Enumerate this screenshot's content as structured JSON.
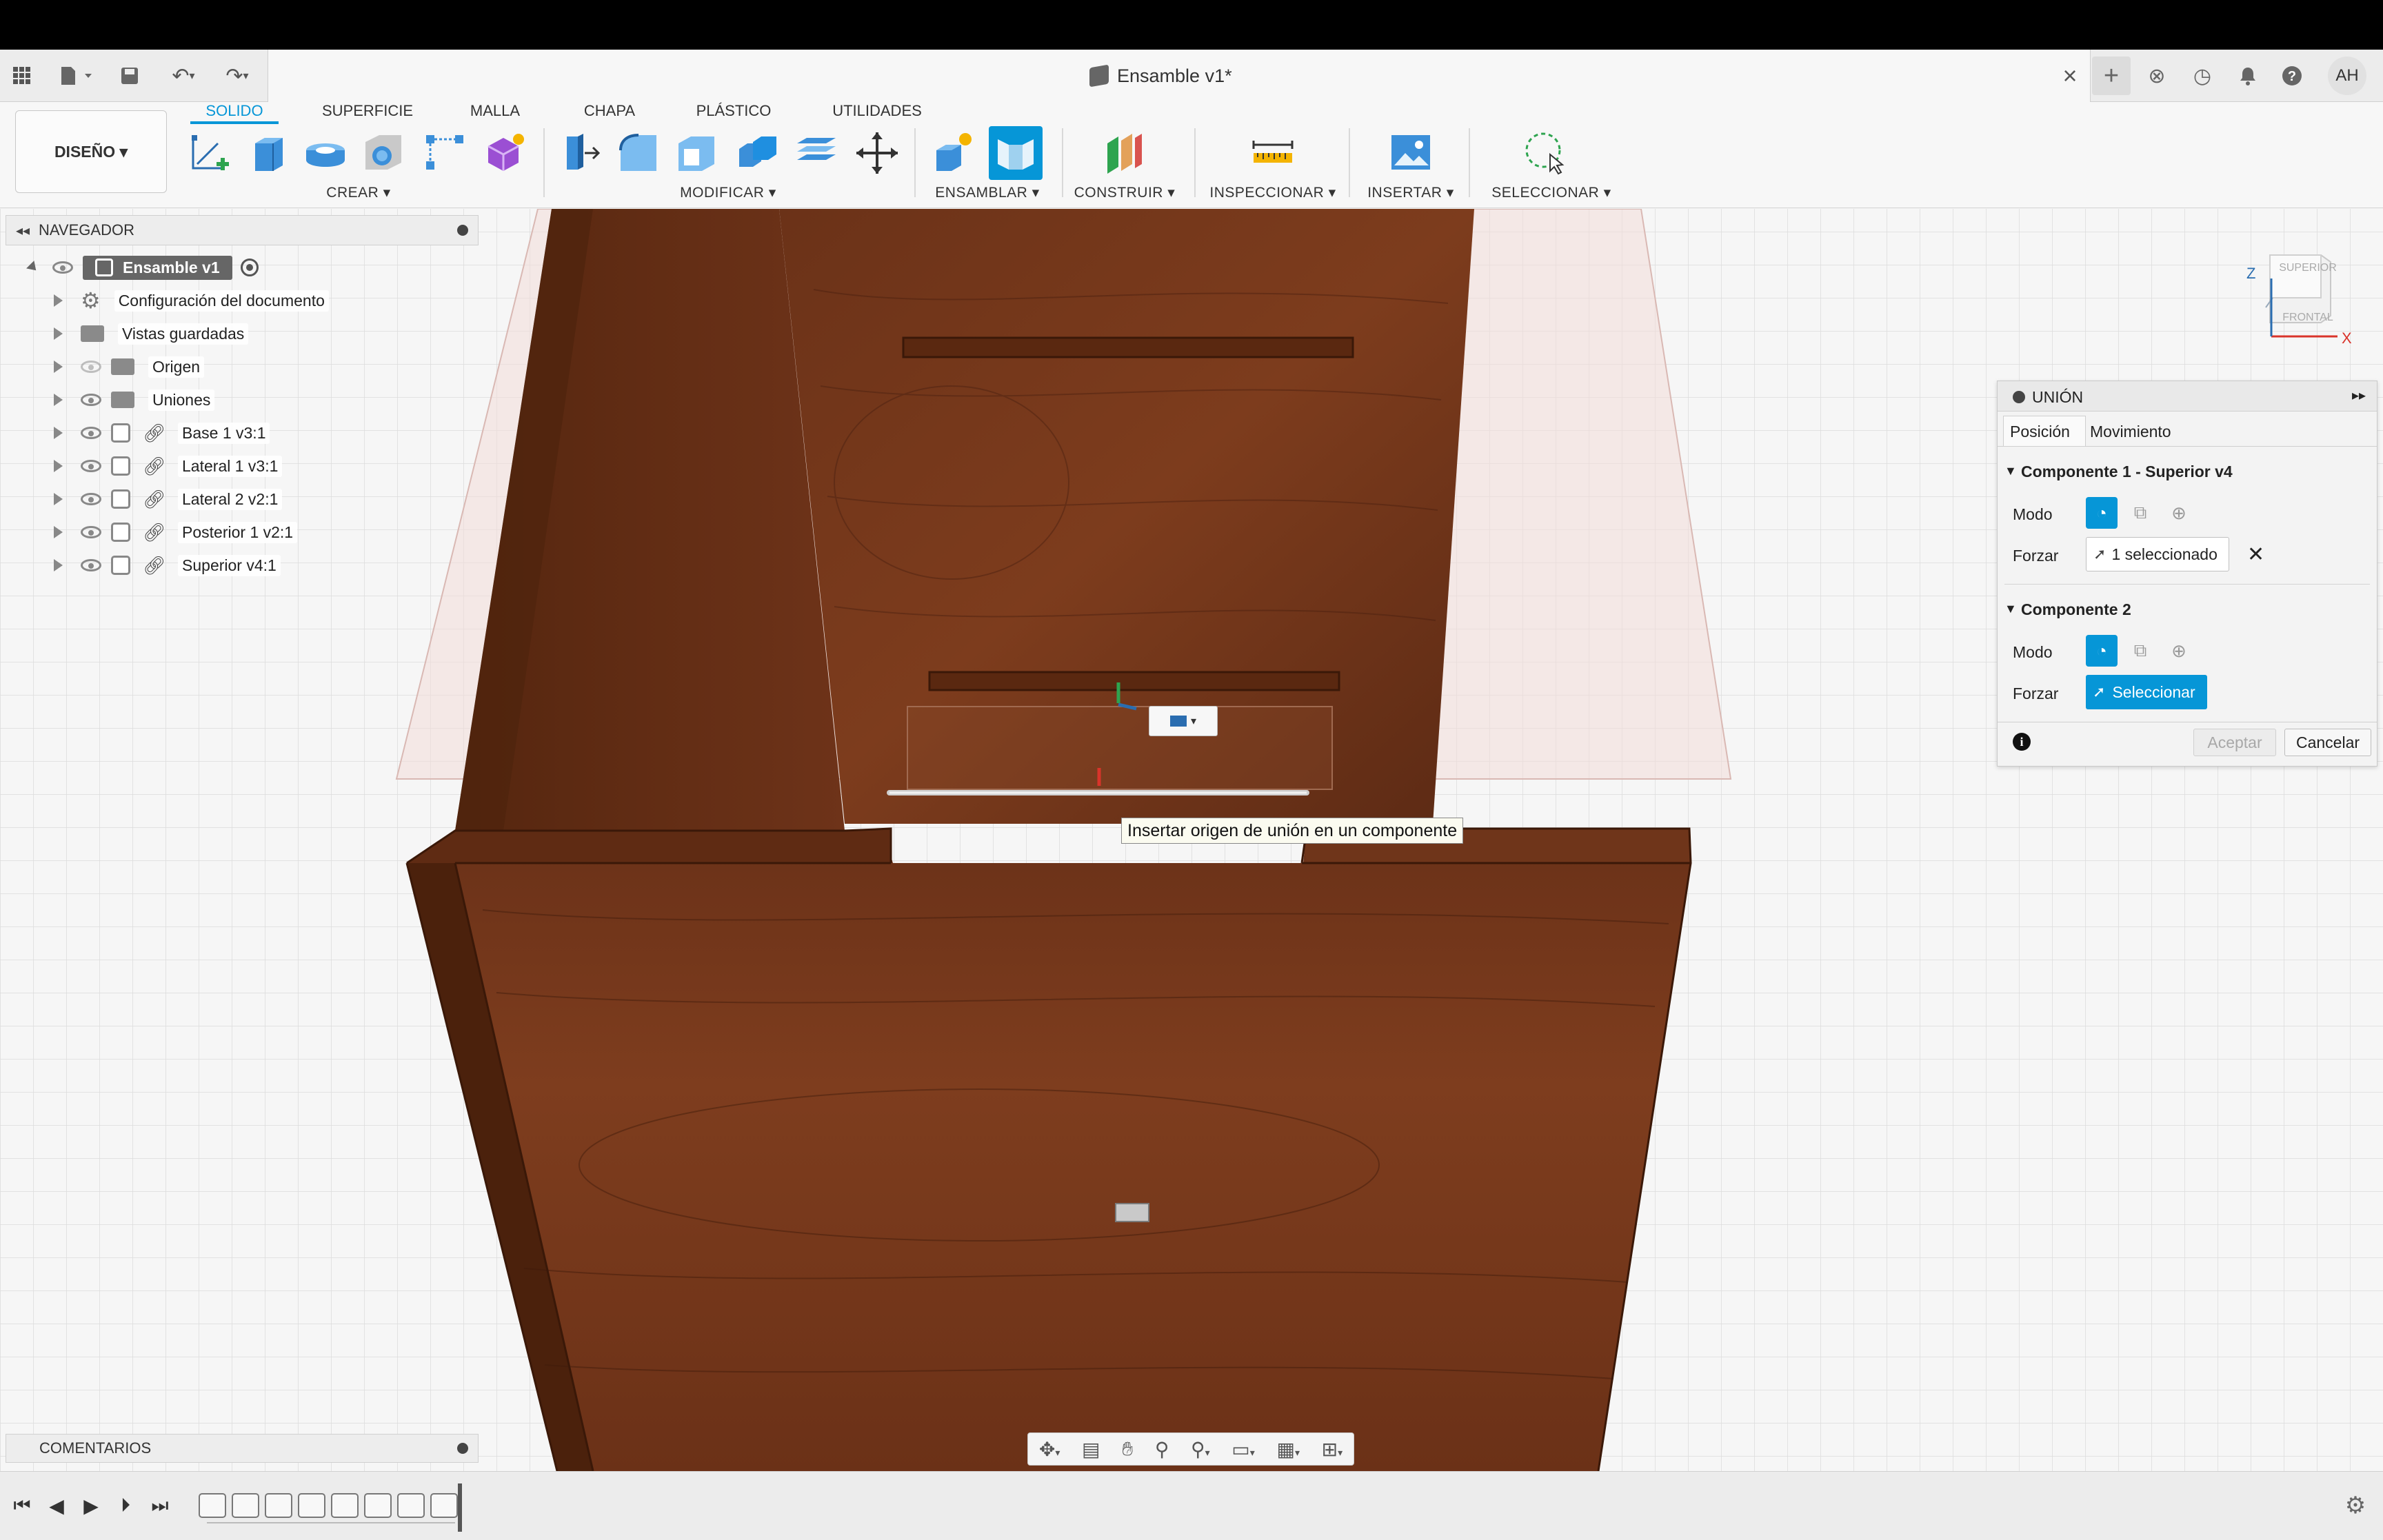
{
  "app": {
    "document_title": "Ensamble v1*",
    "avatar_initials": "AH"
  },
  "ribbon": {
    "workspace": "DISEÑO ▾",
    "tabs": [
      "SOLIDO",
      "SUPERFICIE",
      "MALLA",
      "CHAPA",
      "PLÁSTICO",
      "UTILIDADES"
    ],
    "active_tab": "SOLIDO",
    "groups": {
      "create": "CREAR ▾",
      "modify": "MODIFICAR ▾",
      "assemble": "ENSAMBLAR ▾",
      "construct": "CONSTRUIR ▾",
      "inspect": "INSPECCIONAR ▾",
      "insert": "INSERTAR ▾",
      "select": "SELECCIONAR ▾"
    }
  },
  "navigator": {
    "title": "NAVEGADOR",
    "root": "Ensamble v1",
    "items": [
      {
        "label": "Configuración del documento",
        "icon": "gear-icon"
      },
      {
        "label": "Vistas guardadas",
        "icon": "folder-icon"
      },
      {
        "label": "Origen",
        "icon": "folder-icon"
      },
      {
        "label": "Uniones",
        "icon": "folder-icon"
      },
      {
        "label": "Base 1 v3:1",
        "icon": "component-icon"
      },
      {
        "label": "Lateral 1 v3:1",
        "icon": "component-icon"
      },
      {
        "label": "Lateral 2 v2:1",
        "icon": "component-icon"
      },
      {
        "label": "Posterior 1 v2:1",
        "icon": "component-icon"
      },
      {
        "label": "Superior v4:1",
        "icon": "component-icon"
      }
    ]
  },
  "comments": {
    "title": "COMENTARIOS"
  },
  "joint_panel": {
    "title": "UNIÓN",
    "tabs": [
      "Posición",
      "Movimiento"
    ],
    "component1": {
      "heading": "Componente 1 - Superior v4",
      "mode_label": "Modo",
      "snap_label": "Forzar",
      "snap_value": "1 seleccionado"
    },
    "component2": {
      "heading": "Componente 2",
      "mode_label": "Modo",
      "snap_label": "Forzar",
      "snap_value": "Seleccionar"
    },
    "ok": "Aceptar",
    "cancel": "Cancelar"
  },
  "viewcube": {
    "top": "SUPERIOR",
    "front": "FRONTAL",
    "z": "Z",
    "x": "X"
  },
  "tooltip": "Insertar origen de unión en un componente",
  "colors": {
    "accent": "#0696d7",
    "wood": "#7a3a1c"
  }
}
